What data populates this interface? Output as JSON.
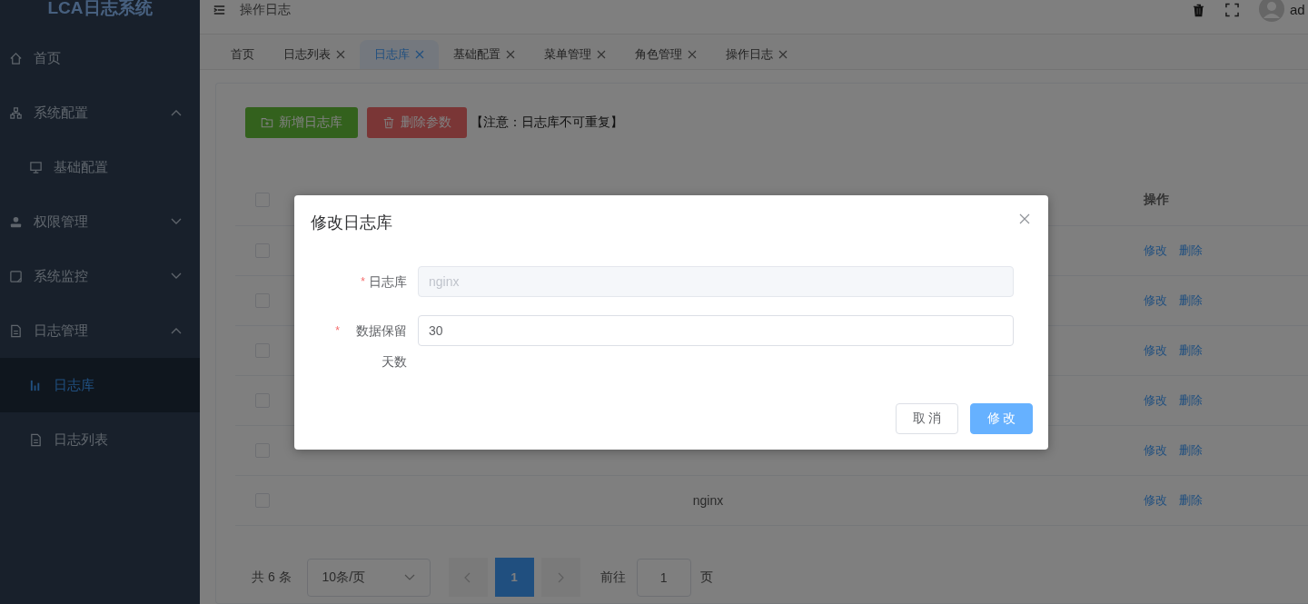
{
  "logo": "LCA日志系统",
  "sidebar": {
    "items": [
      {
        "label": "首页",
        "selected": false
      },
      {
        "label": "系统配置",
        "selected": false,
        "expanded": true,
        "children": [
          {
            "label": "基础配置",
            "selected": false
          }
        ]
      },
      {
        "label": "权限管理",
        "selected": false,
        "expanded": false
      },
      {
        "label": "系统监控",
        "selected": false,
        "expanded": false
      },
      {
        "label": "日志管理",
        "selected": false,
        "expanded": true,
        "children": [
          {
            "label": "日志库",
            "selected": true
          },
          {
            "label": "日志列表",
            "selected": false
          }
        ]
      }
    ]
  },
  "header": {
    "title": "操作日志",
    "user": "ad"
  },
  "tabs": [
    {
      "label": "首页",
      "closable": false,
      "selected": false
    },
    {
      "label": "日志列表",
      "closable": true,
      "selected": false
    },
    {
      "label": "日志库",
      "closable": true,
      "selected": true
    },
    {
      "label": "基础配置",
      "closable": true,
      "selected": false
    },
    {
      "label": "菜单管理",
      "closable": true,
      "selected": false
    },
    {
      "label": "角色管理",
      "closable": true,
      "selected": false
    },
    {
      "label": "操作日志",
      "closable": true,
      "selected": false
    }
  ],
  "toolbar": {
    "add_button": "新增日志库",
    "delete_button": "删除参数",
    "note": "【注意：日志库不可重复】"
  },
  "table": {
    "columns": [
      "操作"
    ],
    "header_checked": false,
    "rows": [
      {
        "checked": false,
        "actions": [
          "修改",
          "删除"
        ]
      },
      {
        "checked": false,
        "actions": [
          "修改",
          "删除"
        ]
      },
      {
        "checked": false,
        "actions": [
          "修改",
          "删除"
        ]
      },
      {
        "checked": false,
        "actions": [
          "修改",
          "删除"
        ]
      },
      {
        "checked": false,
        "actions": [
          "修改",
          "删除"
        ]
      },
      {
        "checked": false,
        "name": "nginx",
        "actions": [
          "修改",
          "删除"
        ]
      }
    ]
  },
  "pagination": {
    "total": "共 6 条",
    "page_size": "10条/页",
    "pages": [
      {
        "label": "1",
        "selected": true
      }
    ],
    "goto_label": "前往",
    "goto_value": "1",
    "page_suffix": "页"
  },
  "dialog": {
    "title": "修改日志库",
    "fields": [
      {
        "label": "日志库",
        "required_mark": "*",
        "value": "nginx",
        "disabled": true
      },
      {
        "label": "数据保留天数",
        "required_mark": "*",
        "value": "30",
        "disabled": false
      }
    ],
    "buttons": [
      {
        "label": "取 消",
        "primary": false
      },
      {
        "label": "修 改",
        "primary": true
      }
    ]
  }
}
